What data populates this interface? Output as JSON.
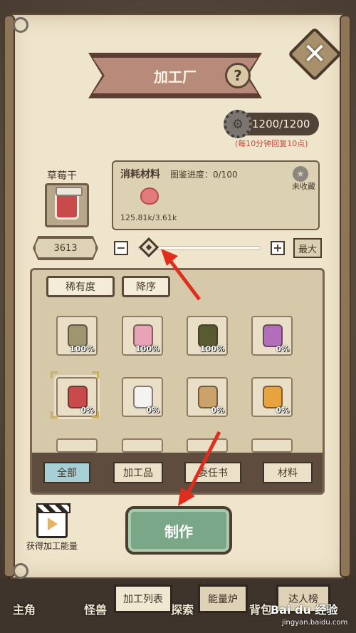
{
  "header": {
    "title": "加工厂",
    "help_symbol": "?",
    "close_symbol": "✕"
  },
  "energy": {
    "value": "1200/1200",
    "note": "(每10分钟回复10点)"
  },
  "product": {
    "name": "草莓干"
  },
  "materials": {
    "title": "消耗材料",
    "progress": "图鉴进度：0/100",
    "uncollected": "未收藏",
    "amount": "125.81k/3.61k"
  },
  "quantity": {
    "value": "3613",
    "minus": "−",
    "plus": "+",
    "max_label": "最大",
    "slider_fraction": 0.05
  },
  "sort": {
    "rarity": "稀有度",
    "order": "降序"
  },
  "items": [
    {
      "pct": "100%",
      "color": "#9f9670",
      "icon": "perfume-bottle-icon"
    },
    {
      "pct": "100%",
      "color": "#e6a4b6",
      "icon": "lotion-bottle-icon"
    },
    {
      "pct": "100%",
      "color": "#5a5a32",
      "icon": "jam-jar-icon"
    },
    {
      "pct": "0%",
      "color": "#b06fb8",
      "icon": "pendant-icon"
    },
    {
      "pct": "0%",
      "color": "#c94a4a",
      "icon": "strawberry-jar-icon"
    },
    {
      "pct": "0%",
      "color": "#f3f3f1",
      "icon": "flour-bag-icon"
    },
    {
      "pct": "0%",
      "color": "#caa26a",
      "icon": "cookie-icon"
    },
    {
      "pct": "0%",
      "color": "#e7a43e",
      "icon": "honey-jar-icon"
    }
  ],
  "filters": [
    "全部",
    "加工品",
    "委任书",
    "材料"
  ],
  "make_button": "制作",
  "energy_get": "获得加工能量",
  "bottom_nav": {
    "left1": "主角",
    "left2": "怪兽",
    "left3": "探索",
    "tab_list": "加工列表",
    "tab_furnace": "能量炉",
    "tab_rank": "达人榜",
    "left4": "背包"
  },
  "watermark": {
    "brand": "Bai du 经验",
    "url": "jingyan.baidu.com"
  }
}
